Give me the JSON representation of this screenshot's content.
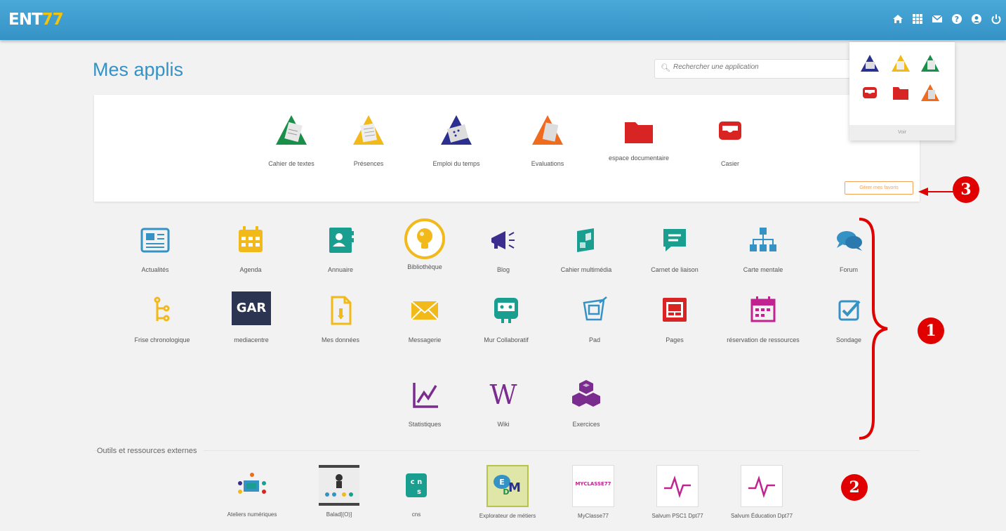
{
  "header": {
    "logo_text": "ENT",
    "logo_suffix": "77"
  },
  "page": {
    "title": "Mes applis"
  },
  "search": {
    "placeholder": "Rechercher une application"
  },
  "favorites": {
    "items": [
      {
        "label": "Cahier de textes",
        "icon": "cahier-textes-icon"
      },
      {
        "label": "Présences",
        "icon": "presences-icon"
      },
      {
        "label": "Emploi du temps",
        "icon": "emploi-temps-icon"
      },
      {
        "label": "Evaluations",
        "icon": "evaluations-icon"
      },
      {
        "label": "espace documentaire",
        "icon": "folder-icon"
      },
      {
        "label": "Casier",
        "icon": "inbox-icon"
      }
    ],
    "button_label": "Gérer mes favoris"
  },
  "popup": {
    "footer": "Voir"
  },
  "apps": [
    {
      "label": "Actualités",
      "icon": "newspaper-icon"
    },
    {
      "label": "Agenda",
      "icon": "calendar-icon"
    },
    {
      "label": "Annuaire",
      "icon": "address-book-icon"
    },
    {
      "label": "Bibliothèque",
      "icon": "bulb-icon"
    },
    {
      "label": "Blog",
      "icon": "megaphone-icon"
    },
    {
      "label": "Cahier multimédia",
      "icon": "multimedia-book-icon"
    },
    {
      "label": "Carnet de liaison",
      "icon": "chat-note-icon"
    },
    {
      "label": "Carte mentale",
      "icon": "hierarchy-icon"
    },
    {
      "label": "Forum",
      "icon": "speech-bubbles-icon"
    },
    {
      "label": "Frise chronologique",
      "icon": "timeline-icon"
    },
    {
      "label": "mediacentre",
      "icon": "gar-icon",
      "text": "GAR"
    },
    {
      "label": "Mes données",
      "icon": "document-icon"
    },
    {
      "label": "Messagerie",
      "icon": "envelope-icon"
    },
    {
      "label": "Mur Collaboratif",
      "icon": "collab-wall-icon"
    },
    {
      "label": "Pad",
      "icon": "pad-icon"
    },
    {
      "label": "Pages",
      "icon": "pages-icon"
    },
    {
      "label": "réservation de ressources",
      "icon": "reservation-calendar-icon"
    },
    {
      "label": "Sondage",
      "icon": "checkbox-icon"
    },
    {
      "label": "Statistiques",
      "icon": "chart-icon"
    },
    {
      "label": "Wiki",
      "icon": "wiki-icon",
      "text": "W"
    },
    {
      "label": "Exercices",
      "icon": "cubes-icon"
    }
  ],
  "external": {
    "title": "Outils et ressources externes",
    "items": [
      {
        "label": "Ateliers numériques",
        "icon": "ateliers-icon"
      },
      {
        "label": "Balad[(O)]",
        "icon": "balad-icon"
      },
      {
        "label": "cns",
        "icon": "cns-icon",
        "text": "cns"
      },
      {
        "label": "Explorateur de métiers",
        "icon": "explorateur-icon"
      },
      {
        "label": "MyClasse77",
        "icon": "myclasse-icon",
        "text": "MYCLASSE77"
      },
      {
        "label": "Salvum PSC1 Dpt77",
        "icon": "salvum-icon"
      },
      {
        "label": "Salvum Éducation Dpt77",
        "icon": "salvum-icon"
      }
    ]
  },
  "annotations": {
    "one": "1",
    "two": "2",
    "three": "3"
  },
  "colors": {
    "topbar": "#3592c5",
    "accent_red": "#e00000",
    "title_blue": "#3592c5"
  }
}
